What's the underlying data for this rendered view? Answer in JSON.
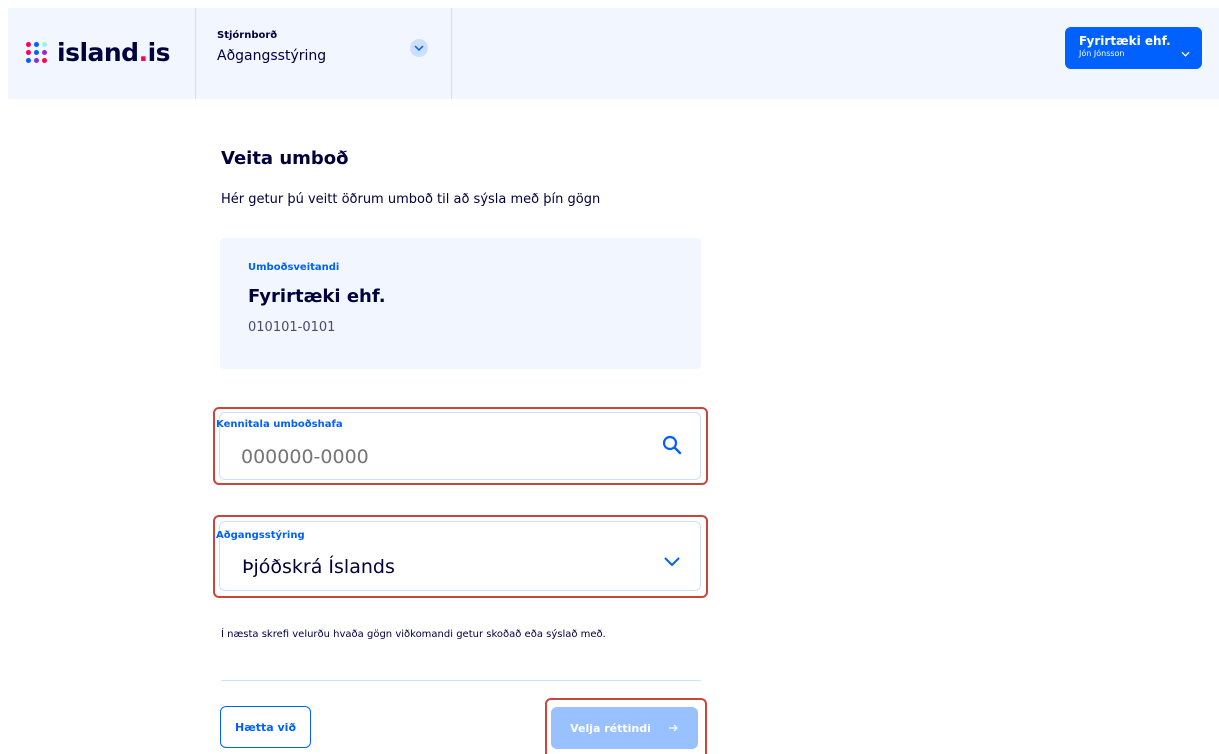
{
  "header": {
    "logo_text": "island",
    "logo_dot": ".",
    "logo_suffix": "is",
    "breadcrumb_small": "Stjórnborð",
    "breadcrumb_main": "Aðgangsstýring",
    "user_company": "Fyrirtæki ehf.",
    "user_person": "Jón Jónsson"
  },
  "main": {
    "title": "Veita umboð",
    "description": "Hér getur þú veitt öðrum umboð til að sýsla með þín gögn",
    "grantor": {
      "label": "Umboðsveitandi",
      "name": "Fyrirtæki ehf.",
      "id": "010101-0101"
    },
    "recipient_field": {
      "label": "Kennitala umboðshafa",
      "placeholder": "000000-0000"
    },
    "access_field": {
      "label": "Aðgangsstýring",
      "value": "Þjóðskrá Íslands"
    },
    "note": "Í næsta skrefi velurðu hvaða gögn viðkomandi getur skoðað eða sýslað með.",
    "cancel_label": "Hætta við",
    "next_label": "Velja réttindi"
  },
  "colors": {
    "accent": "#0061ff",
    "header_bg": "#f2f7ff",
    "highlight": "#c8473a",
    "disabled_button": "#99c0ff"
  },
  "icons": {
    "logo": "dots-grid-icon",
    "breadcrumb_toggle": "chevron-down-icon",
    "user_menu": "chevron-down-icon",
    "search": "search-icon",
    "select": "chevron-down-icon",
    "next": "arrow-right-icon"
  }
}
